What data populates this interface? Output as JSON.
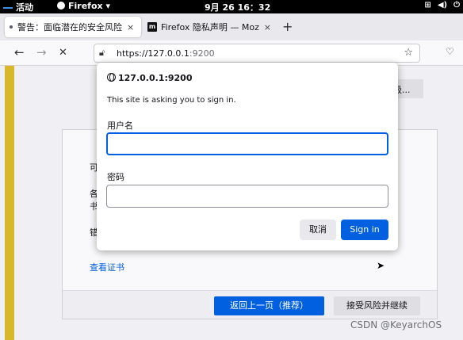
{
  "topbar": {
    "activities": "活动",
    "app_name": "Firefox ▾",
    "clock": "9月 26 16：32"
  },
  "tabs": [
    {
      "label": "警告：面临潜在的安全风险",
      "close": "×"
    },
    {
      "label": "Firefox 隐私声明 — Mozil",
      "close": "×"
    }
  ],
  "new_tab": "+",
  "nav": {
    "back": "←",
    "forward": "→",
    "stop": "✕",
    "url_host": "https://127.0.0.1",
    "url_port": ":9200",
    "bookmark": "☆",
    "pocket": "♡"
  },
  "page": {
    "advanced_label": "级...",
    "detail_lines": [
      "可",
      "各",
      "书",
      "错"
    ],
    "view_cert": "查看证书",
    "go_back": "返回上一页（推荐）",
    "accept_risk": "接受风险并继续",
    "watermark": "CSDN @KeyarchOS"
  },
  "dialog": {
    "origin": "127.0.0.1:9200",
    "message": "This site is asking you to sign in.",
    "username_label": "用户名",
    "username_value": "",
    "password_label": "密码",
    "password_value": "",
    "cancel": "取消",
    "sign_in": "Sign in"
  },
  "colors": {
    "accent": "#0060df",
    "warning_bar": "#d8b829"
  }
}
